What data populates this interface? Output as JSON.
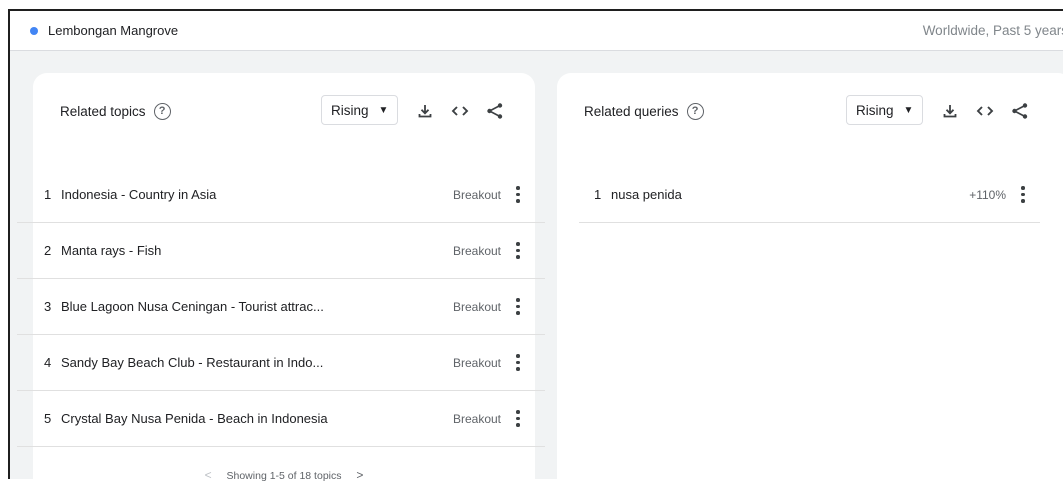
{
  "header": {
    "search_term": "Lembongan Mangrove",
    "term_color": "#4285f4",
    "scope": "Worldwide, Past 5 years"
  },
  "topics": {
    "title": "Related topics",
    "help_icon": "help-circle-icon",
    "filter": "Rising",
    "items": [
      {
        "rank": "1",
        "name": "Indonesia - Country in Asia",
        "value": "Breakout"
      },
      {
        "rank": "2",
        "name": "Manta rays - Fish",
        "value": "Breakout"
      },
      {
        "rank": "3",
        "name": "Blue Lagoon Nusa Ceningan - Tourist attrac...",
        "value": "Breakout"
      },
      {
        "rank": "4",
        "name": "Sandy Bay Beach Club - Restaurant in Indo...",
        "value": "Breakout"
      },
      {
        "rank": "5",
        "name": "Crystal Bay Nusa Penida - Beach in Indonesia",
        "value": "Breakout"
      }
    ],
    "pager": "Showing 1-5 of 18 topics"
  },
  "queries": {
    "title": "Related queries",
    "filter": "Rising",
    "items": [
      {
        "rank": "1",
        "name": "nusa penida",
        "value": "+110%"
      }
    ]
  },
  "tools": [
    "download-icon",
    "embed-code-icon",
    "share-icon"
  ]
}
